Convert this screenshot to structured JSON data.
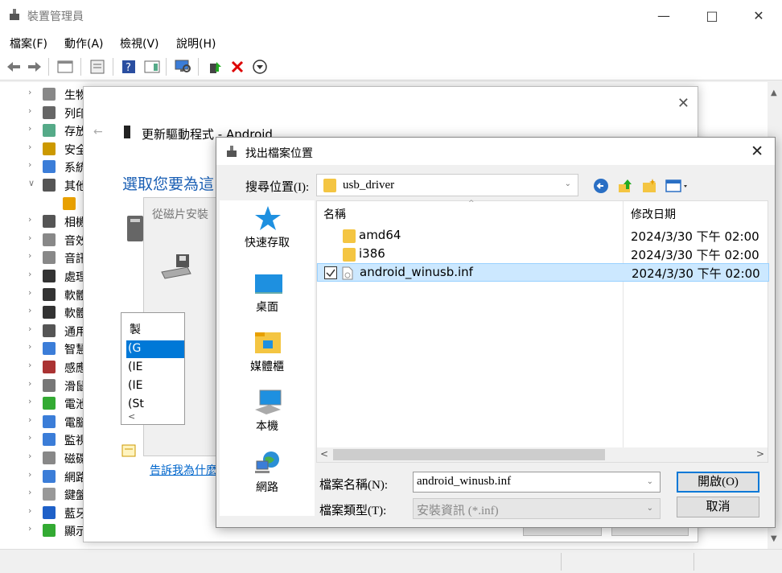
{
  "dm": {
    "title": "裝置管理員",
    "menu": [
      "檔案(F)",
      "動作(A)",
      "檢視(V)",
      "說明(H)"
    ],
    "tree": [
      "生物",
      "列印",
      "存放",
      "安全",
      "系統",
      "其他",
      "",
      "相機",
      "音效",
      "音訊",
      "處理",
      "軟體",
      "軟體",
      "通用",
      "智慧",
      "感應",
      "滑鼠",
      "電池",
      "電腦",
      "監視",
      "磁碟",
      "網路",
      "鍵盤",
      "藍牙",
      "顯示"
    ]
  },
  "update_dialog": {
    "title": "更新驅動程式 - Android",
    "heading": "選取您要為這",
    "link": "告訴我為什麼",
    "list_header": "製",
    "list_items": [
      "(G",
      "(IE",
      "(IE",
      "(St"
    ]
  },
  "disk_dialog": {
    "title": "從磁片安裝"
  },
  "file_open": {
    "title": "找出檔案位置",
    "look_in_label": "搜尋位置(I):",
    "look_in_value": "usb_driver",
    "places": [
      "快速存取",
      "桌面",
      "媒體櫃",
      "本機",
      "網路"
    ],
    "col_name": "名稱",
    "col_date": "修改日期",
    "files": [
      {
        "name": "amd64",
        "date": "2024/3/30 下午 02:00"
      },
      {
        "name": "i386",
        "date": "2024/3/30 下午 02:00"
      },
      {
        "name": "android_winusb.inf",
        "date": "2024/3/30 下午 02:00"
      }
    ],
    "filename_label": "檔案名稱(N):",
    "filename_value": "android_winusb.inf",
    "filetype_label": "檔案類型(T):",
    "filetype_value": "安裝資訊 (*.inf)",
    "open_button": "開啟(O)",
    "cancel_button": "取消"
  }
}
